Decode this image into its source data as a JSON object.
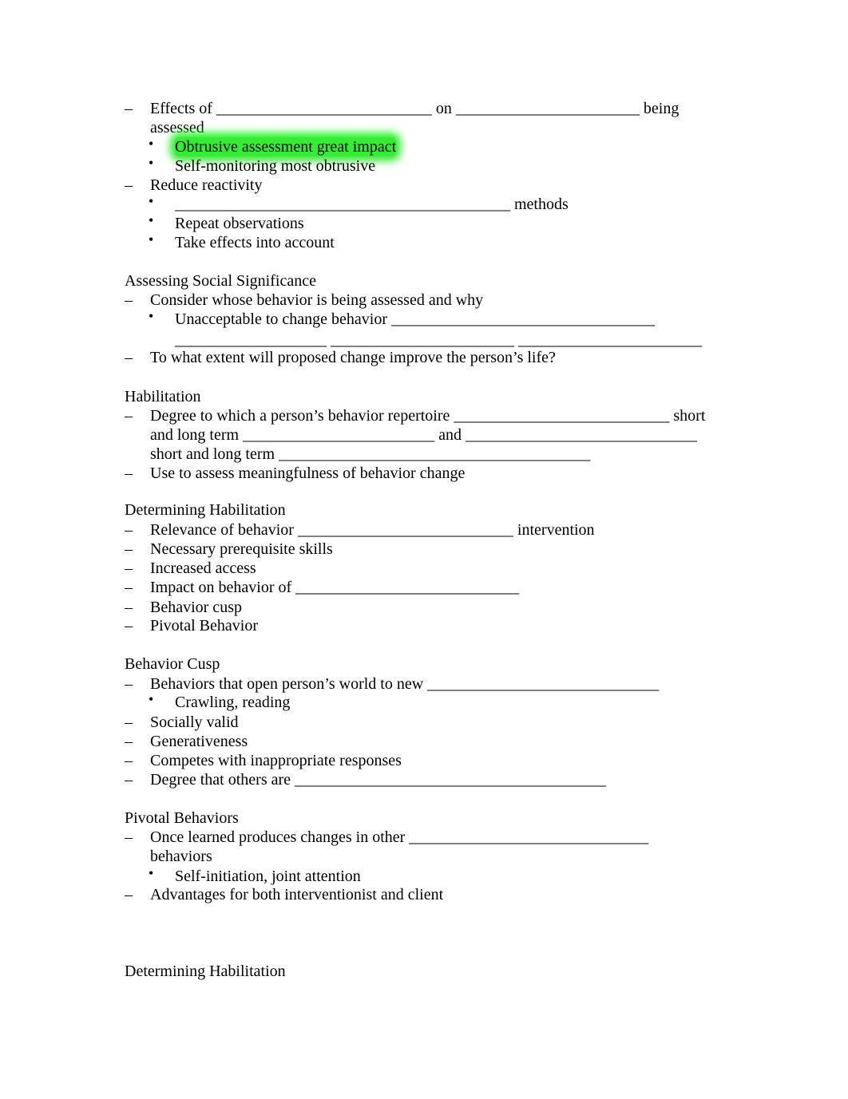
{
  "document": {
    "lines": [
      {
        "type": "dash",
        "text": "Effects of ___________________________ on _______________________ being"
      },
      {
        "type": "cont",
        "text": "assessed"
      },
      {
        "type": "bullet",
        "text": "Obtrusive assessment great impact",
        "highlight": "#33ee33"
      },
      {
        "type": "bullet",
        "text": "Self-monitoring most obtrusive"
      },
      {
        "type": "dash",
        "text": "Reduce reactivity"
      },
      {
        "type": "bullet",
        "text": "__________________________________________ methods"
      },
      {
        "type": "bullet",
        "text": "Repeat observations"
      },
      {
        "type": "bullet",
        "text": "Take effects into account"
      },
      {
        "type": "heading",
        "text": "Assessing Social Significance"
      },
      {
        "type": "dash",
        "text": "Consider whose behavior is being assessed and why"
      },
      {
        "type": "bullet",
        "text": "Unacceptable to change behavior _________________________________"
      },
      {
        "type": "cont2",
        "text": "___________________ _______________________ _______________________"
      },
      {
        "type": "dash",
        "text": "To what extent will proposed change improve the person’s life?"
      },
      {
        "type": "heading",
        "text": "Habilitation"
      },
      {
        "type": "dash",
        "text": "Degree to which a person’s behavior repertoire ___________________________ short"
      },
      {
        "type": "cont",
        "text": "and long term ________________________ and _____________________________"
      },
      {
        "type": "cont",
        "text": "short and long term _______________________________________"
      },
      {
        "type": "dash",
        "text": "Use to assess meaningfulness of behavior change"
      },
      {
        "type": "heading",
        "text": "Determining Habilitation"
      },
      {
        "type": "dash",
        "text": "Relevance of behavior ___________________________ intervention"
      },
      {
        "type": "dash",
        "text": "Necessary prerequisite skills"
      },
      {
        "type": "dash",
        "text": "Increased access"
      },
      {
        "type": "dash",
        "text": "Impact on behavior of ____________________________"
      },
      {
        "type": "dash",
        "text": "Behavior cusp"
      },
      {
        "type": "dash",
        "text": "Pivotal Behavior"
      },
      {
        "type": "heading",
        "text": "Behavior Cusp"
      },
      {
        "type": "dash",
        "text": "Behaviors that open person’s world to new _____________________________"
      },
      {
        "type": "bullet",
        "text": "Crawling, reading"
      },
      {
        "type": "dash",
        "text": "Socially valid"
      },
      {
        "type": "dash",
        "text": "Generativeness"
      },
      {
        "type": "dash",
        "text": "Competes with inappropriate responses"
      },
      {
        "type": "dash",
        "text": "Degree that others are _______________________________________"
      },
      {
        "type": "heading",
        "text": "Pivotal Behaviors"
      },
      {
        "type": "dash",
        "text": "Once learned produces changes in other ______________________________"
      },
      {
        "type": "cont",
        "text": "behaviors"
      },
      {
        "type": "bullet",
        "text": "Self-initiation, joint attention"
      },
      {
        "type": "dash",
        "text": "Advantages for both interventionist and client"
      },
      {
        "type": "heading",
        "text": "Determining Habilitation"
      }
    ],
    "markers": {
      "dash": "–",
      "bullet": "•"
    }
  }
}
